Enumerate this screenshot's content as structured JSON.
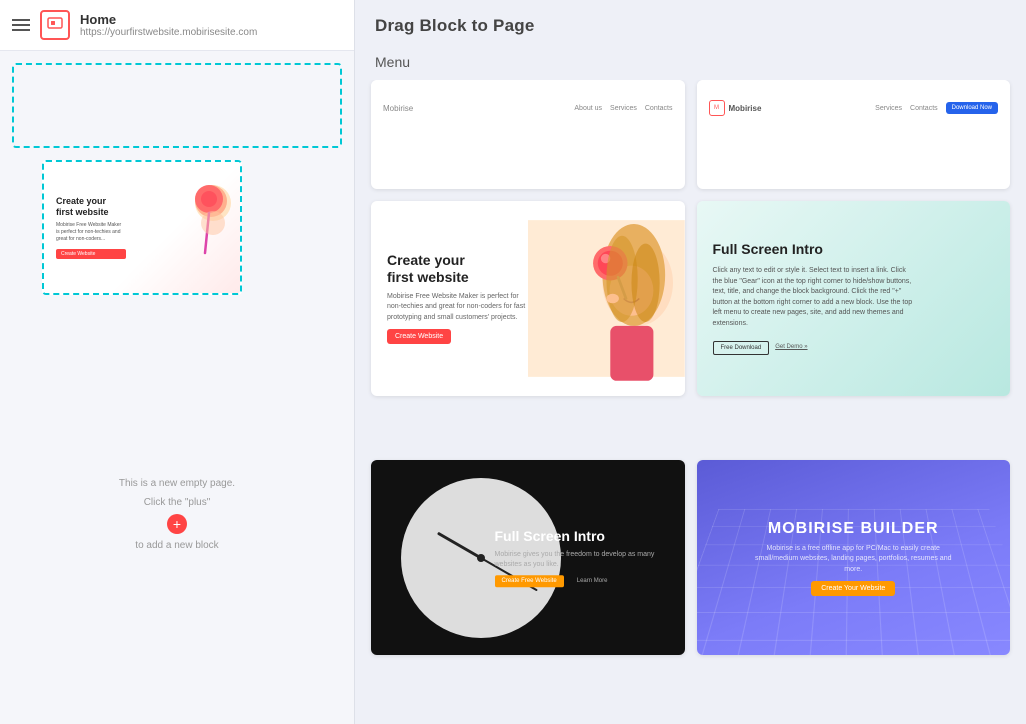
{
  "sidebar": {
    "header": {
      "title": "Home",
      "url": "https://yourfirstwebsite.mobirisesite.com"
    },
    "empty_page": {
      "line1": "This is a new empty page.",
      "line2": "Click the \"plus\"",
      "line3": "to add a new block"
    }
  },
  "right_panel": {
    "drag_title": "Drag Block to Page",
    "section_menu": "Menu",
    "blocks": [
      {
        "id": "menu-white",
        "type": "menu",
        "logo": "Mobirise",
        "links": [
          "About us",
          "Services",
          "Contacts"
        ]
      },
      {
        "id": "menu-colored",
        "type": "menu-colored",
        "logo": "Mobirise",
        "links": [
          "Services",
          "Contacts"
        ],
        "cta": "Download Now"
      },
      {
        "id": "hero-create",
        "type": "hero",
        "title": "Create your\nfirst website",
        "body": "Mobirise Free Website Maker is perfect for non-techies and great for non-coders for fast prototyping and small customers' projects.",
        "cta": "Create Website"
      },
      {
        "id": "fullscreen-light",
        "type": "fullscreen-light",
        "title": "Full Screen Intro",
        "body": "Click any text to edit or style it. Select text to insert a link. Click the blue \"Gear\" icon at the top right corner to hide/show buttons, text, title, and change the block background. Click the red \"+\" button at the bottom right corner to add a new block. Use the top left menu to create new pages, site, and add new themes and extensions.",
        "btn1": "Free Download",
        "btn2": "Get Demo »"
      },
      {
        "id": "fullscreen-dark",
        "type": "fullscreen-dark",
        "title": "Full Screen Intro",
        "body": "Mobirise gives you the freedom to develop as many websites as you like.",
        "btn1": "Create Free Website",
        "btn2": "Learn More"
      },
      {
        "id": "mobirise-builder",
        "type": "builder",
        "title": "MOBIRISE BUILDER",
        "body": "Mobirise is a free offline app for PC/Mac to easily create small/medium websites, landing pages, portfolios, resumes and more.",
        "btn": "Create Your Website"
      }
    ]
  }
}
